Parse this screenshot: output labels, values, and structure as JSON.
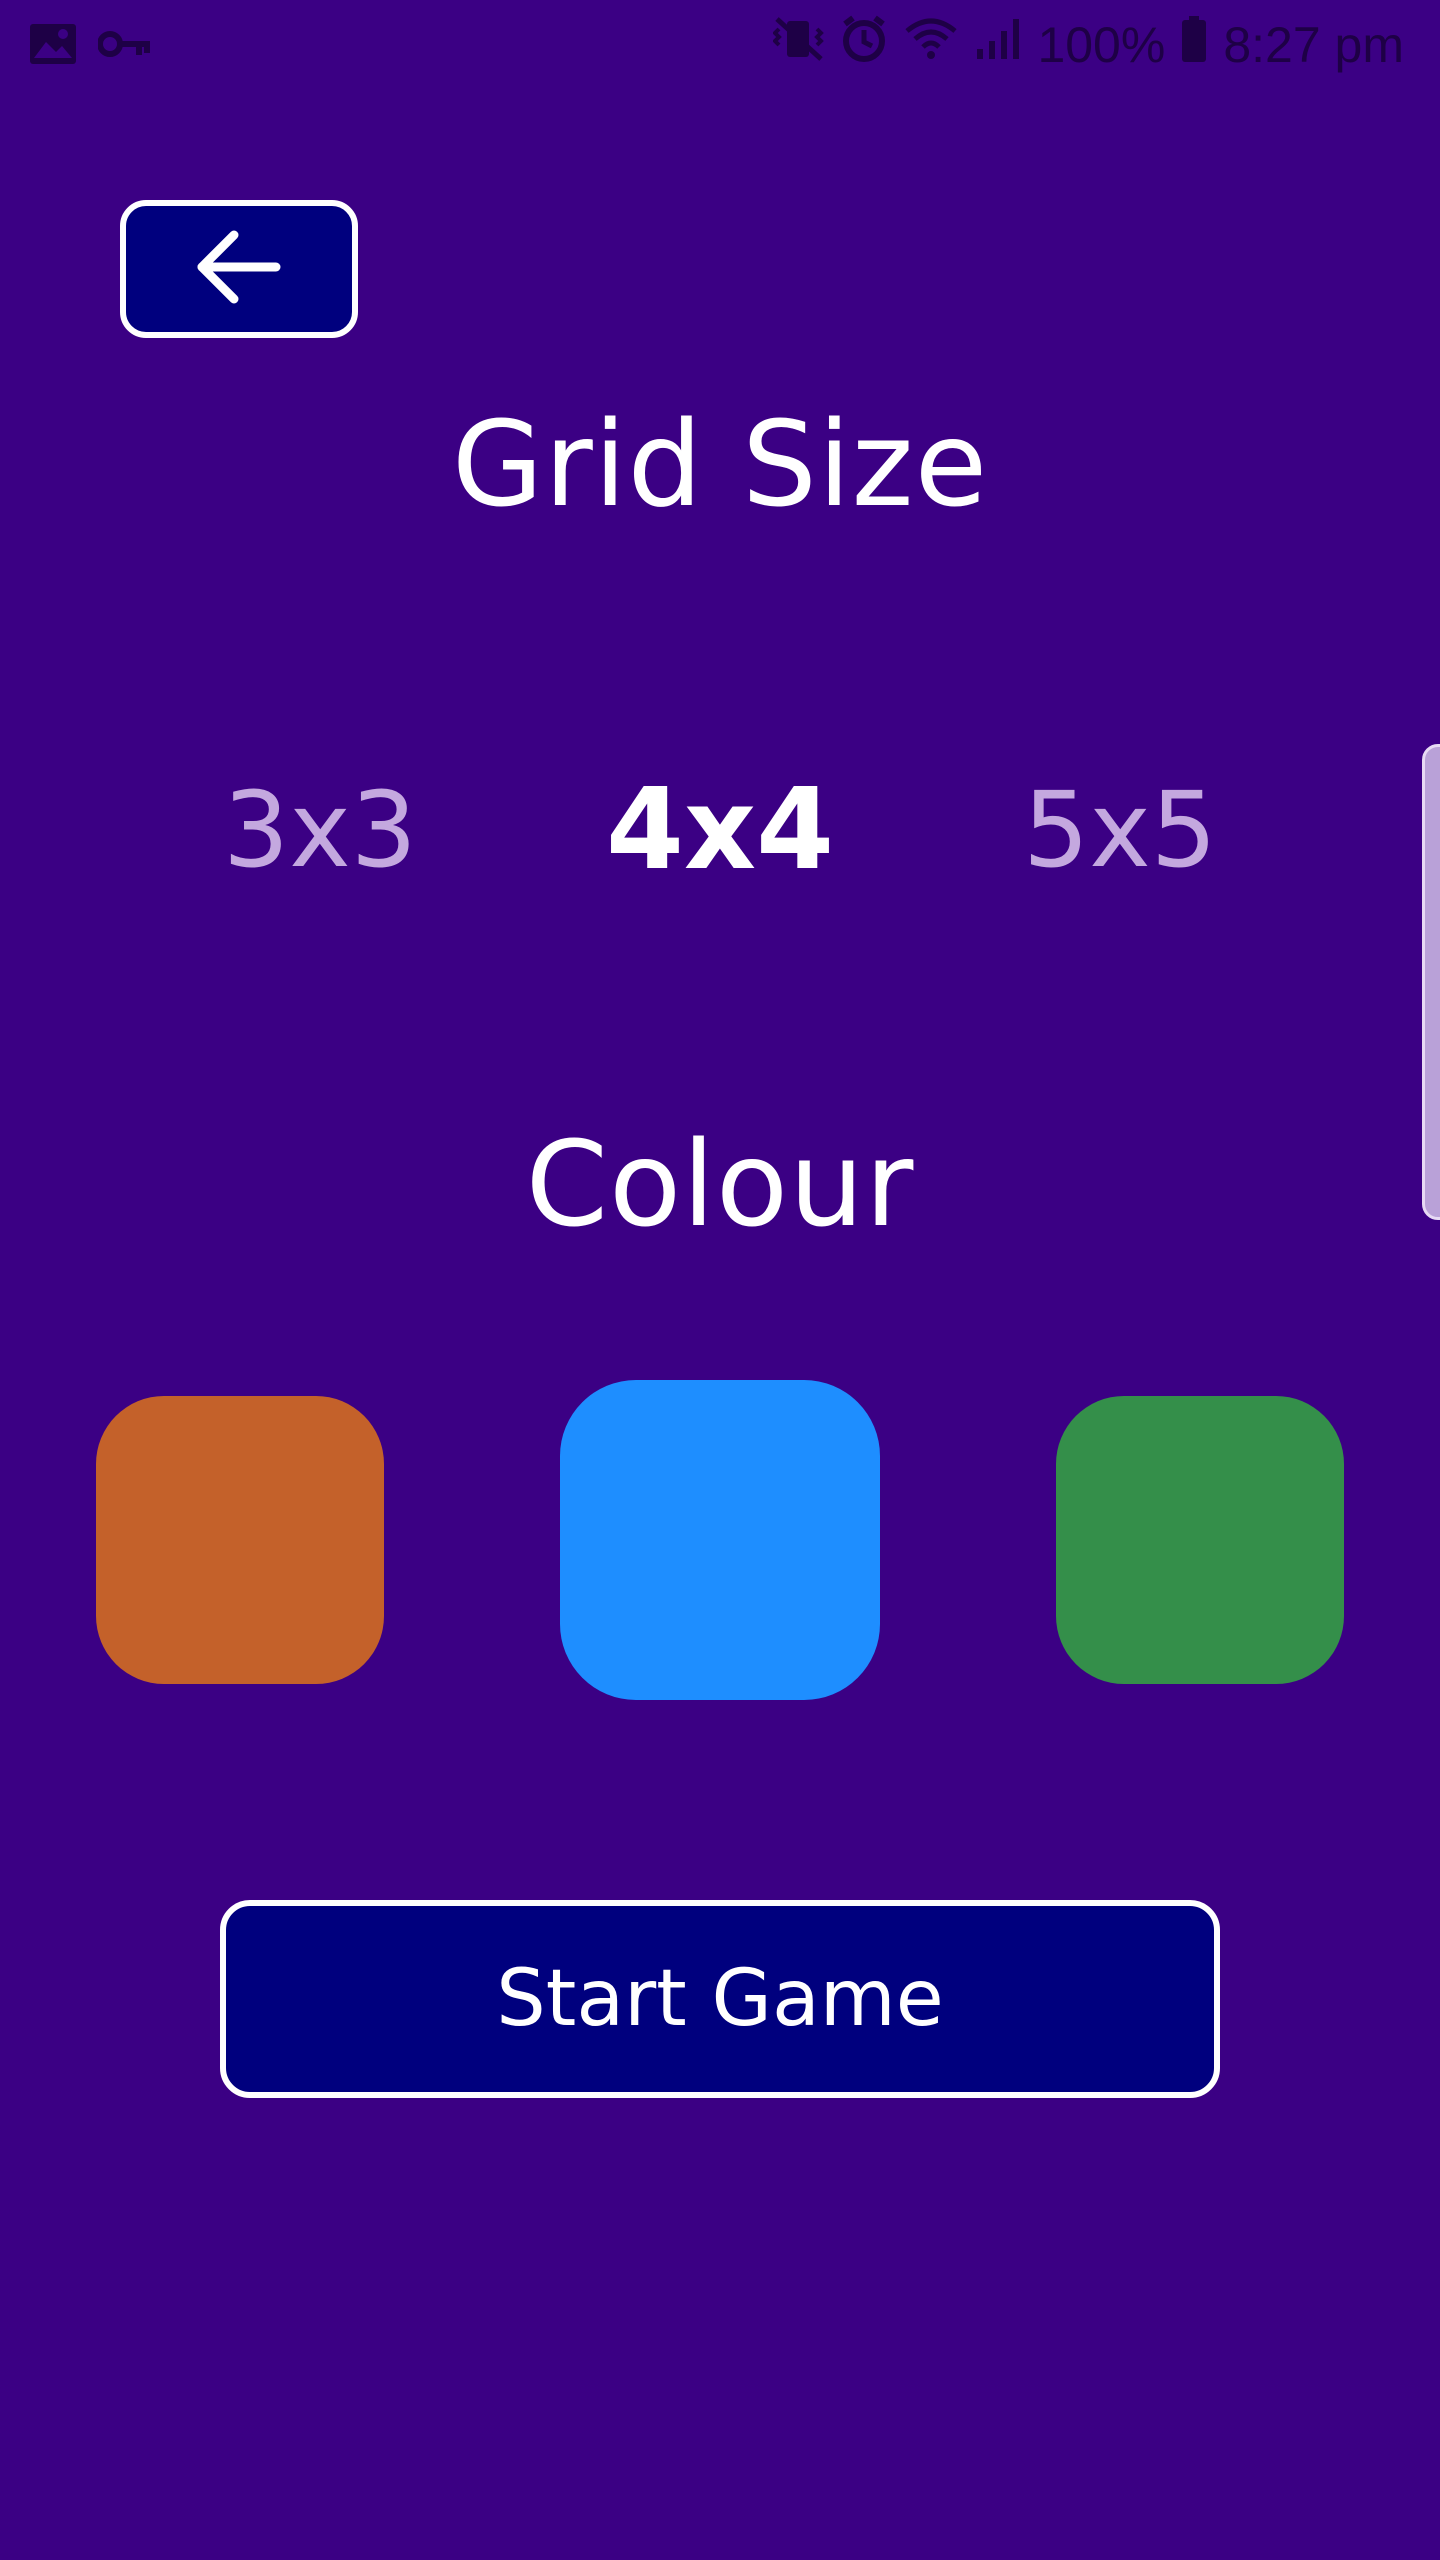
{
  "status_bar": {
    "battery_text": "100%",
    "time": "8:27 pm",
    "icons": [
      "image-icon",
      "key-icon",
      "vibrate-mute-icon",
      "alarm-icon",
      "wifi-icon",
      "signal-icon",
      "battery-icon"
    ]
  },
  "header": {
    "back_icon": "arrow-left-icon"
  },
  "grid_size": {
    "title": "Grid Size",
    "options": [
      {
        "label": "3x3",
        "selected": false
      },
      {
        "label": "4x4",
        "selected": true
      },
      {
        "label": "5x5",
        "selected": false
      }
    ]
  },
  "colour": {
    "title": "Colour",
    "swatches": [
      {
        "name": "orange",
        "color": "#c4612a",
        "selected": false
      },
      {
        "name": "blue",
        "color": "#1e8eff",
        "selected": true
      },
      {
        "name": "green",
        "color": "#348f4a",
        "selected": false
      }
    ]
  },
  "actions": {
    "start_label": "Start Game"
  },
  "theme": {
    "background": "#3b0084",
    "button_bg": "#00007e",
    "dim_text": "#c4a8df"
  }
}
